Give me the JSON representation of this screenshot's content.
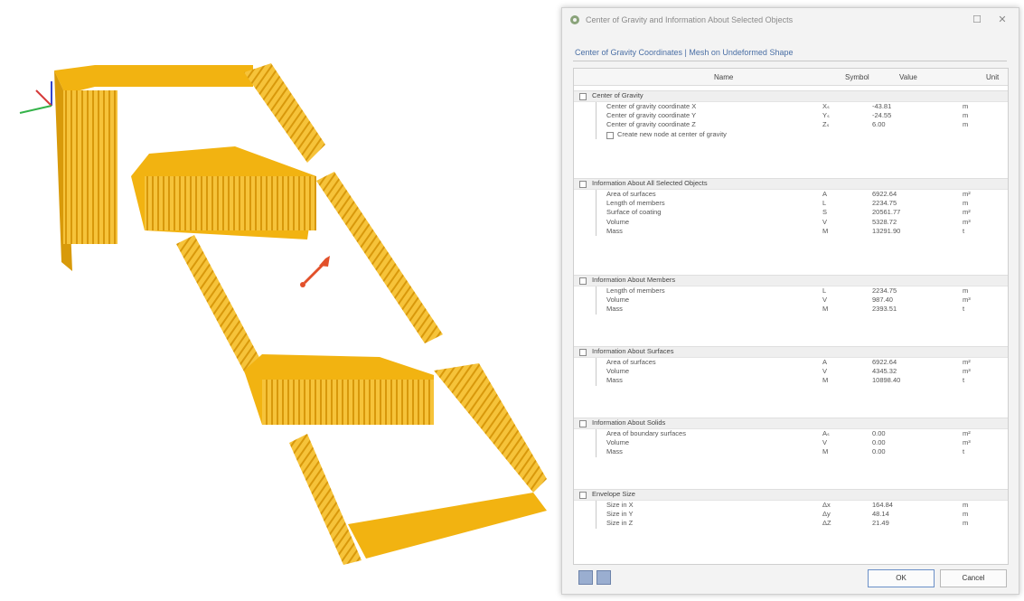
{
  "dialog": {
    "title": "Center of Gravity and Information About Selected Objects",
    "tab_label": "Center of Gravity Coordinates | Mesh on Undeformed Shape",
    "columns": {
      "name": "Name",
      "symbol": "Symbol",
      "value": "Value",
      "unit": "Unit"
    },
    "sections": [
      {
        "title": "Center of Gravity",
        "rows": [
          {
            "name": "Center of gravity coordinate X",
            "symbol": "Xₛ",
            "value": "-43.81",
            "unit": "m"
          },
          {
            "name": "Center of gravity coordinate Y",
            "symbol": "Yₛ",
            "value": "-24.55",
            "unit": "m"
          },
          {
            "name": "Center of gravity coordinate Z",
            "symbol": "Zₛ",
            "value": "6.00",
            "unit": "m"
          }
        ]
      },
      {
        "title": "Information About All Selected Objects",
        "rows": [
          {
            "name": "Area of surfaces",
            "symbol": "A",
            "value": "6922.64",
            "unit": "m²"
          },
          {
            "name": "Length of members",
            "symbol": "L",
            "value": "2234.75",
            "unit": "m"
          },
          {
            "name": "Surface of coating",
            "symbol": "S",
            "value": "20561.77",
            "unit": "m²"
          },
          {
            "name": "Volume",
            "symbol": "V",
            "value": "5328.72",
            "unit": "m³"
          },
          {
            "name": "Mass",
            "symbol": "M",
            "value": "13291.90",
            "unit": "t"
          }
        ]
      },
      {
        "title": "Information About Members",
        "rows": [
          {
            "name": "Length of members",
            "symbol": "L",
            "value": "2234.75",
            "unit": "m"
          },
          {
            "name": "Volume",
            "symbol": "V",
            "value": "987.40",
            "unit": "m³"
          },
          {
            "name": "Mass",
            "symbol": "M",
            "value": "2393.51",
            "unit": "t"
          }
        ]
      },
      {
        "title": "Information About Surfaces",
        "rows": [
          {
            "name": "Area of surfaces",
            "symbol": "A",
            "value": "6922.64",
            "unit": "m²"
          },
          {
            "name": "Volume",
            "symbol": "V",
            "value": "4345.32",
            "unit": "m³"
          },
          {
            "name": "Mass",
            "symbol": "M",
            "value": "10898.40",
            "unit": "t"
          }
        ]
      },
      {
        "title": "Information About Solids",
        "rows": [
          {
            "name": "Area of boundary surfaces",
            "symbol": "Aₛ",
            "value": "0.00",
            "unit": "m²"
          },
          {
            "name": "Volume",
            "symbol": "V",
            "value": "0.00",
            "unit": "m³"
          },
          {
            "name": "Mass",
            "symbol": "M",
            "value": "0.00",
            "unit": "t"
          }
        ]
      },
      {
        "title": "Envelope Size",
        "rows": [
          {
            "name": "Size in X",
            "symbol": "Δx",
            "value": "164.84",
            "unit": "m"
          },
          {
            "name": "Size in Y",
            "symbol": "Δy",
            "value": "48.14",
            "unit": "m"
          },
          {
            "name": "Size in Z",
            "symbol": "ΔZ",
            "value": "21.49",
            "unit": "m"
          }
        ]
      }
    ],
    "create_node_label": "Create new node at center of gravity",
    "ok_label": "OK",
    "cancel_label": "Cancel",
    "maximize_glyph": "☐",
    "close_glyph": "✕"
  },
  "icons": {
    "app": "rfem-app-icon",
    "help": "help-icon",
    "info": "info-icon",
    "cog_marker": "center-of-gravity-arrow-icon"
  },
  "colors": {
    "model": "#f2b311",
    "model_shadow": "#d89a0a",
    "cog_arrow": "#e2502a",
    "axis_x": "#d63a3a",
    "axis_y": "#35b34a",
    "axis_z": "#3344cc"
  }
}
